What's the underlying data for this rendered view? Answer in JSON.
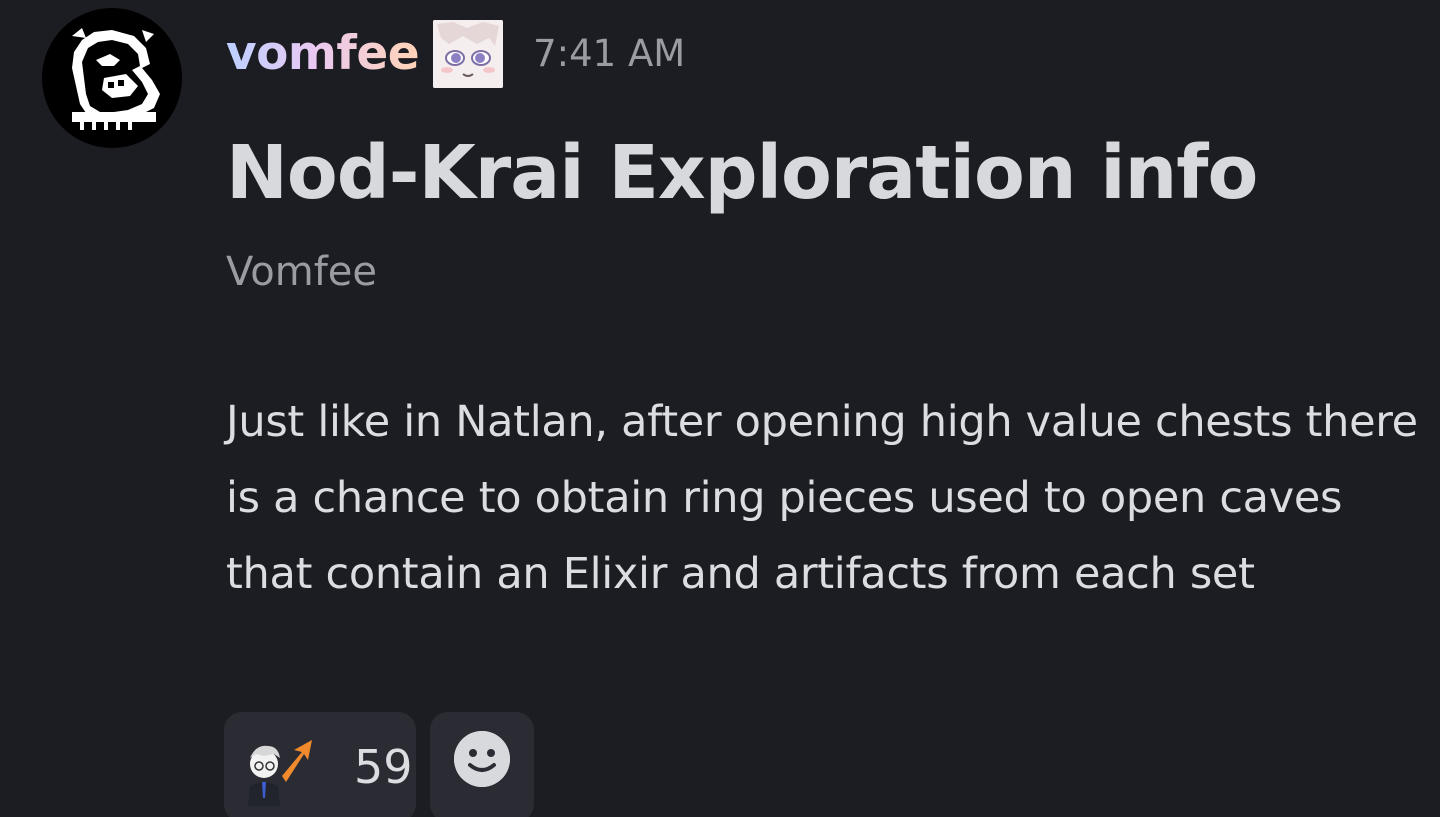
{
  "message": {
    "author": "vomfee",
    "timestamp": "7:41 AM",
    "title": "Nod-Krai Exploration info",
    "subtext": "Vomfee",
    "body": "Just like in Natlan, after opening high value chests there is a chance to obtain ring pieces used to open caves that contain an Elixir and artifacts from each set",
    "avatar_icon": "pixel-dragon-avatar-icon",
    "role_icon": "anime-face-role-icon"
  },
  "reactions": [
    {
      "emoji_icon": "anime-character-arrow-up-emoji-icon",
      "count": "59"
    }
  ],
  "add_reaction": {
    "icon": "smiley-add-reaction-icon"
  }
}
